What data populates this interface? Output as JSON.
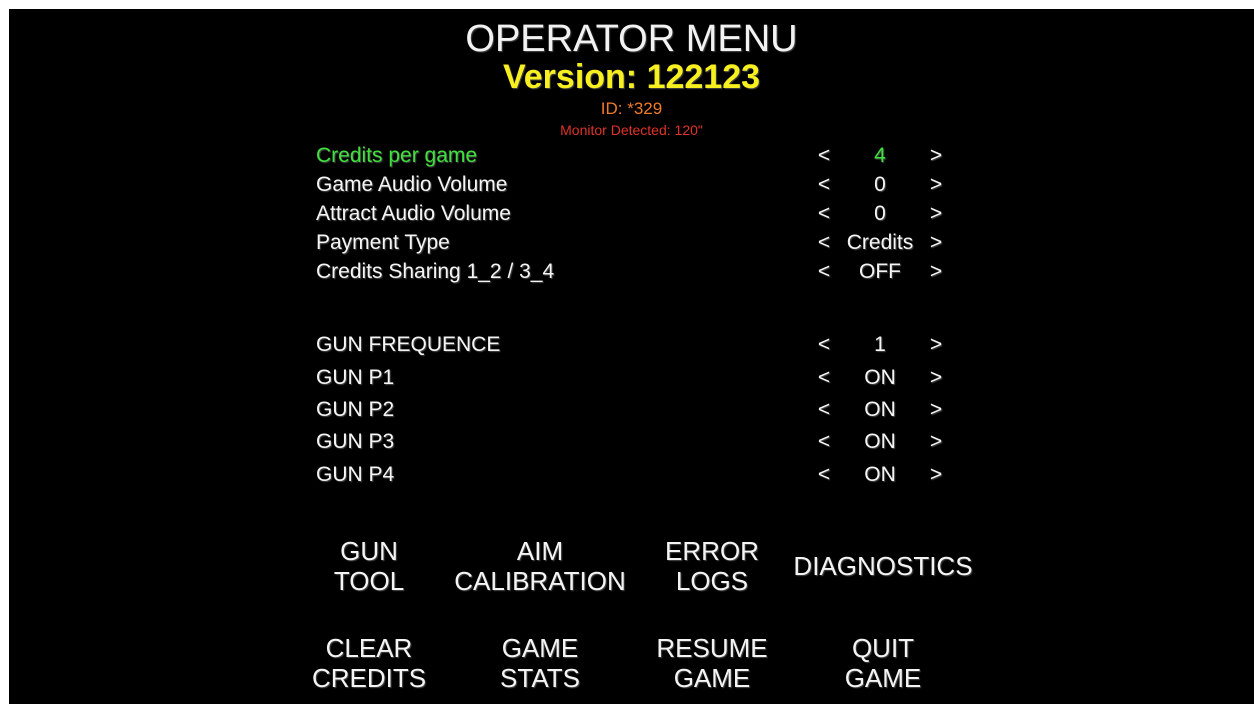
{
  "header": {
    "title": "OPERATOR MENU",
    "version": "Version: 122123",
    "id": "ID: *329",
    "monitor": "Monitor Detected: 120\""
  },
  "arrows": {
    "left": "<",
    "right": ">"
  },
  "settings": [
    {
      "label": "Credits per game",
      "value": "4",
      "selected": true
    },
    {
      "label": "Game Audio Volume",
      "value": "0"
    },
    {
      "label": "Attract Audio Volume",
      "value": "0"
    },
    {
      "label": "Payment Type",
      "value": "Credits"
    },
    {
      "label": "Credits Sharing 1_2 / 3_4",
      "value": "OFF"
    },
    {
      "label": "GUN FREQUENCE",
      "value": "1"
    },
    {
      "label": "GUN P1",
      "value": "ON"
    },
    {
      "label": "GUN P2",
      "value": "ON"
    },
    {
      "label": "GUN P3",
      "value": "ON"
    },
    {
      "label": "GUN P4",
      "value": "ON"
    }
  ],
  "buttons": [
    {
      "lines": [
        "GUN",
        "TOOL"
      ]
    },
    {
      "lines": [
        "AIM",
        "CALIBRATION"
      ]
    },
    {
      "lines": [
        "ERROR",
        "LOGS"
      ]
    },
    {
      "lines": [
        "DIAGNOSTICS"
      ]
    },
    {
      "lines": [
        "CLEAR",
        "CREDITS"
      ]
    },
    {
      "lines": [
        "GAME",
        "STATS"
      ]
    },
    {
      "lines": [
        "RESUME",
        "GAME"
      ]
    },
    {
      "lines": [
        "QUIT",
        "GAME"
      ]
    }
  ],
  "colors": {
    "background": "#000000",
    "text": "#f4f4f4",
    "version": "#f7f01e",
    "id": "#f07a2a",
    "monitor": "#e0322a",
    "selected": "#3de23a"
  }
}
